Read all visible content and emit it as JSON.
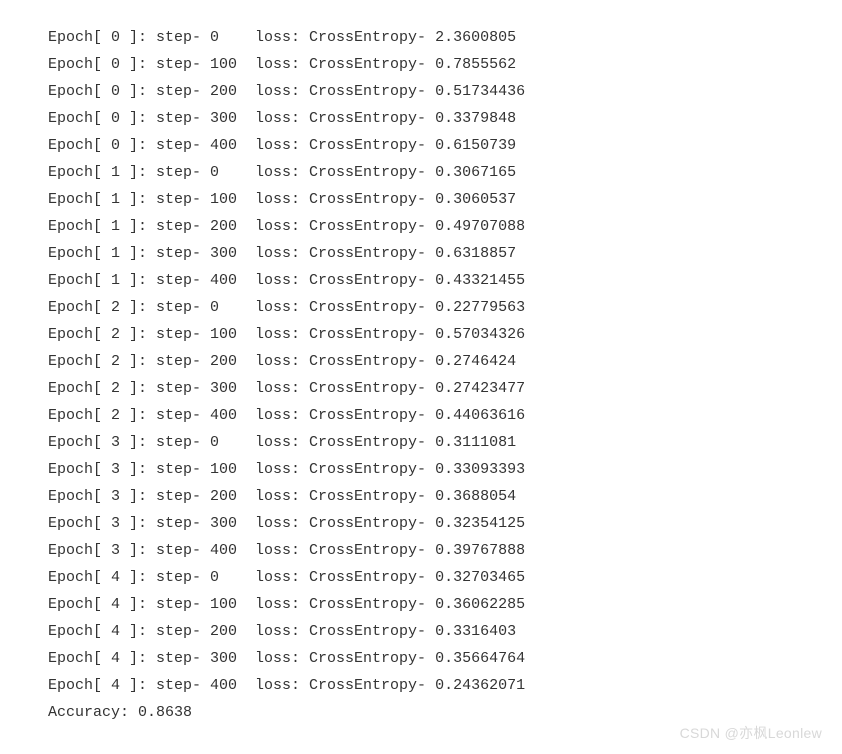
{
  "log": {
    "rows": [
      {
        "epoch": 0,
        "step": 0,
        "loss": "2.3600805"
      },
      {
        "epoch": 0,
        "step": 100,
        "loss": "0.7855562"
      },
      {
        "epoch": 0,
        "step": 200,
        "loss": "0.51734436"
      },
      {
        "epoch": 0,
        "step": 300,
        "loss": "0.3379848"
      },
      {
        "epoch": 0,
        "step": 400,
        "loss": "0.6150739"
      },
      {
        "epoch": 1,
        "step": 0,
        "loss": "0.3067165"
      },
      {
        "epoch": 1,
        "step": 100,
        "loss": "0.3060537"
      },
      {
        "epoch": 1,
        "step": 200,
        "loss": "0.49707088"
      },
      {
        "epoch": 1,
        "step": 300,
        "loss": "0.6318857"
      },
      {
        "epoch": 1,
        "step": 400,
        "loss": "0.43321455"
      },
      {
        "epoch": 2,
        "step": 0,
        "loss": "0.22779563"
      },
      {
        "epoch": 2,
        "step": 100,
        "loss": "0.57034326"
      },
      {
        "epoch": 2,
        "step": 200,
        "loss": "0.2746424"
      },
      {
        "epoch": 2,
        "step": 300,
        "loss": "0.27423477"
      },
      {
        "epoch": 2,
        "step": 400,
        "loss": "0.44063616"
      },
      {
        "epoch": 3,
        "step": 0,
        "loss": "0.3111081"
      },
      {
        "epoch": 3,
        "step": 100,
        "loss": "0.33093393"
      },
      {
        "epoch": 3,
        "step": 200,
        "loss": "0.3688054"
      },
      {
        "epoch": 3,
        "step": 300,
        "loss": "0.32354125"
      },
      {
        "epoch": 3,
        "step": 400,
        "loss": "0.39767888"
      },
      {
        "epoch": 4,
        "step": 0,
        "loss": "0.32703465"
      },
      {
        "epoch": 4,
        "step": 100,
        "loss": "0.36062285"
      },
      {
        "epoch": 4,
        "step": 200,
        "loss": "0.3316403"
      },
      {
        "epoch": 4,
        "step": 300,
        "loss": "0.35664764"
      },
      {
        "epoch": 4,
        "step": 400,
        "loss": "0.24362071"
      }
    ],
    "labels": {
      "epoch_prefix": "Epoch[",
      "epoch_suffix": "]:",
      "step_label": "step-",
      "loss_label": "loss:",
      "loss_name": "CrossEntropy-",
      "accuracy_label": "Accuracy:"
    },
    "accuracy": "0.8638"
  },
  "watermark": "CSDN @亦枫Leonlew"
}
